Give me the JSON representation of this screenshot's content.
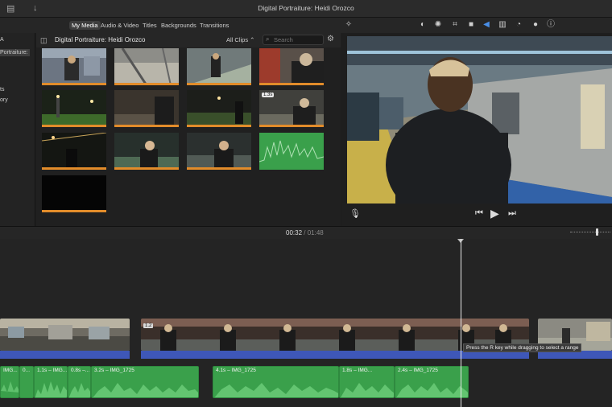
{
  "window": {
    "title": "Digital Portraiture: Heidi Orozco"
  },
  "browser_tabs": [
    {
      "label": "My Media",
      "active": true
    },
    {
      "label": "Audio & Video",
      "active": false
    },
    {
      "label": "Titles",
      "active": false
    },
    {
      "label": "Backgrounds",
      "active": false
    },
    {
      "label": "Transitions",
      "active": false
    }
  ],
  "sidebar": {
    "items": [
      "A",
      "Portraiture:",
      "ts",
      "ory"
    ]
  },
  "browser": {
    "project_name": "Digital Portraiture: Heidi Orozco",
    "filter": "All Clips",
    "search_placeholder": "Search",
    "clip_badge": "1.3s"
  },
  "timecode": {
    "current": "00:32",
    "separator": "/",
    "total": "01:48"
  },
  "timeline": {
    "video_label": "1.2",
    "tooltip": "Press the R key while dragging to select a range",
    "audio_clips": [
      "IMG...",
      "0...",
      "1.1s – IMG...",
      "0.8s –...",
      "3.2s – IMG_1725",
      "4.1s – IMG_1725",
      "1.8s – IMG...",
      "2.4s – IMG_1725"
    ]
  },
  "colors": {
    "accent": "#e28c2a",
    "audio_green": "#3aa04b",
    "audio_blue": "#3e57b8",
    "tool_blue": "#4a8fe8"
  },
  "icons": [
    "film-icon",
    "import-arrow-icon",
    "sidebar-toggle-icon",
    "search-icon",
    "settings-icon",
    "magic-wand-icon",
    "color-balance-icon",
    "color-palette-icon",
    "crop-icon",
    "camera-icon",
    "volume-icon",
    "equalizer-icon",
    "speed-icon",
    "noise-icon",
    "info-icon",
    "microphone-icon",
    "skip-back-icon",
    "play-icon",
    "skip-forward-icon"
  ]
}
